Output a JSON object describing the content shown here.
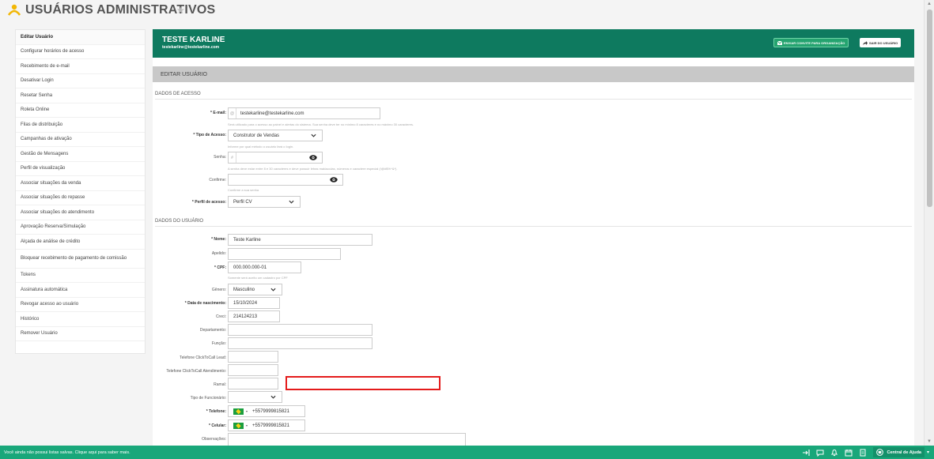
{
  "header": {
    "title": "USUÁRIOS ADMINISTRATIVOS",
    "star": "★"
  },
  "sidebar": {
    "items": [
      {
        "label": "Editar Usuário",
        "active": true
      },
      {
        "label": "Configurar horários de acesso"
      },
      {
        "label": "Recebimento de e-mail"
      },
      {
        "label": "Desativar Login"
      },
      {
        "label": "Resetar Senha"
      },
      {
        "label": "Roleta Online"
      },
      {
        "label": "Filas de distribuição"
      },
      {
        "label": "Campanhas de ativação"
      },
      {
        "label": "Gestão de Mensagens"
      },
      {
        "label": "Perfil de visualização"
      },
      {
        "label": "Associar situações da venda"
      },
      {
        "label": "Associar situações do repasse"
      },
      {
        "label": "Associar situações do atendimento"
      },
      {
        "label": "Aprovação Reserva/Simulação"
      },
      {
        "label": "Alçada de análise de crédito"
      },
      {
        "label": "Bloquear recebimento de pagamento de comissão"
      },
      {
        "label": "Tokens"
      },
      {
        "label": "Assinatura automática"
      },
      {
        "label": "Revogar acesso ao usuário"
      },
      {
        "label": "Histórico"
      },
      {
        "label": "Remover Usuário"
      }
    ]
  },
  "user": {
    "name": "TESTE KARLINE",
    "email": "testekarline@testekarline.com"
  },
  "buttons": {
    "invite": "ENVIAR CONVITE PARA ORGANIZAÇÃO",
    "logout": "SAIR DO USUÁRIO"
  },
  "section_bar": "EDITAR USUÁRIO",
  "access": {
    "title": "DADOS DE ACESSO",
    "email_label": "* E-mail:",
    "email_addon": "@",
    "email_value": "testekarline@testekarline.com",
    "email_help": "Será utilizado para o acesso ao painel e alertas do sistema. Sua senha deve ter no mínimo 8 caracteres e no máximo 30 caracteres.",
    "access_type_label": "* Tipo de Acesso:",
    "access_type_value": "Construtor de Vendas",
    "access_type_help": "Informe por qual método o usuário fará o login.",
    "password_label": "Senha:",
    "password_addon": "#",
    "password_help": "A senha deve estar entre 8 e 30 caracteres e deve possuir letras maiúsculas, números e caractere especial (!@#$%^&*).",
    "confirm_label": "Confirme:",
    "confirm_help": "Confirme a sua senha",
    "profile_label": "* Perfil de acesso:",
    "profile_value": "Perfil CV"
  },
  "user_data": {
    "title": "DADOS DO USUÁRIO",
    "name_label": "* Nome:",
    "name_value": "Teste Karline",
    "nickname_label": "Apelido:",
    "cpf_label": "* CPF:",
    "cpf_value": "000.000.000-01",
    "cpf_help": "Somente será aceito um cadastro por CPF",
    "gender_label": "Gênero:",
    "gender_value": "Masculino",
    "birth_label": "* Data de nascimento:",
    "birth_value": "15/10/2024",
    "creci_label": "Creci:",
    "creci_value": "214124213",
    "department_label": "Departamento:",
    "role_label": "Função:",
    "click_lead_label": "Telefone ClickToCall Lead:",
    "click_service_label": "Telefone ClickToCall Atendimento:",
    "extension_label": "Ramal:",
    "employee_type_label": "Tipo de Funcionário:",
    "phone_label": "* Telefone:",
    "phone_value": "+5579999815821",
    "mobile_label": "* Celular:",
    "mobile_value": "+5579999815821",
    "notes_label": "Observações:"
  },
  "footer": {
    "message": "Você ainda não possui listas salvas. Clique aqui para saber mais.",
    "help_label": "Central de Ajuda",
    "icons": [
      "exit-icon",
      "chat-icon",
      "bell-icon",
      "calendar-icon",
      "document-icon",
      "help-circle-icon"
    ]
  },
  "colors": {
    "brand_green": "#0e7a5f",
    "footer_green": "#19a77a",
    "highlight": "#e41b1b",
    "section_gray": "#c8c8c8"
  }
}
